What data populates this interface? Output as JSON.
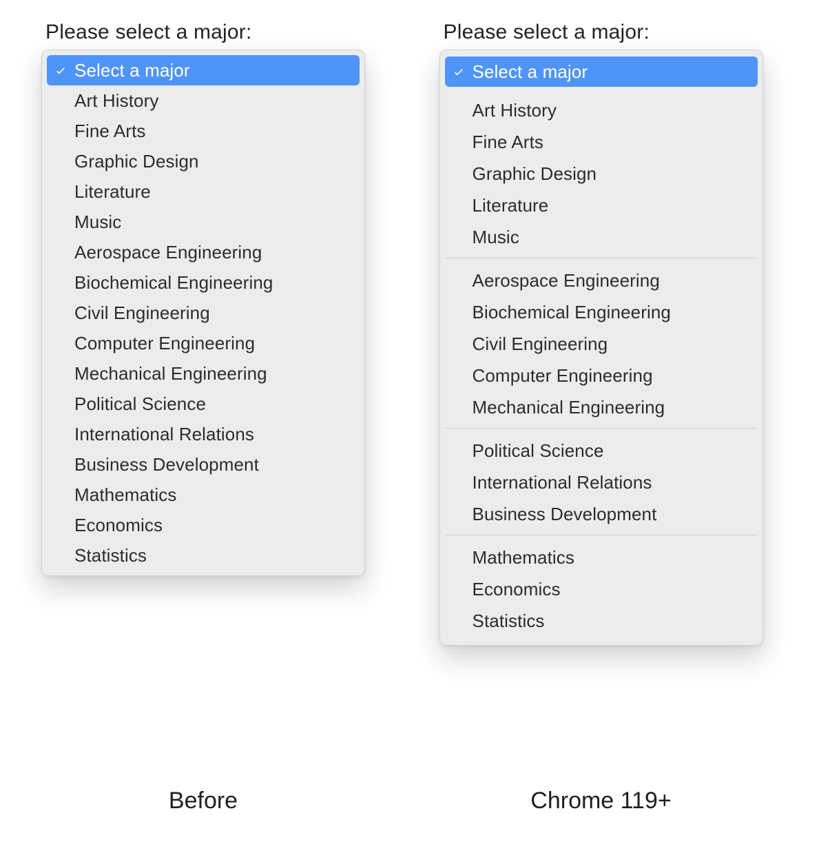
{
  "left": {
    "prompt": "Please select a major:",
    "placeholder": "Select a major",
    "options": [
      "Art History",
      "Fine Arts",
      "Graphic Design",
      "Literature",
      "Music",
      "Aerospace Engineering",
      "Biochemical Engineering",
      "Civil Engineering",
      "Computer Engineering",
      "Mechanical Engineering",
      "Political Science",
      "International Relations",
      "Business Development",
      "Mathematics",
      "Economics",
      "Statistics"
    ],
    "caption": "Before"
  },
  "right": {
    "prompt": "Please select a major:",
    "placeholder": "Select a major",
    "groups": [
      [
        "Art History",
        "Fine Arts",
        "Graphic Design",
        "Literature",
        "Music"
      ],
      [
        "Aerospace Engineering",
        "Biochemical Engineering",
        "Civil Engineering",
        "Computer Engineering",
        "Mechanical Engineering"
      ],
      [
        "Political Science",
        "International Relations",
        "Business Development"
      ],
      [
        "Mathematics",
        "Economics",
        "Statistics"
      ]
    ],
    "caption": "Chrome 119+"
  }
}
